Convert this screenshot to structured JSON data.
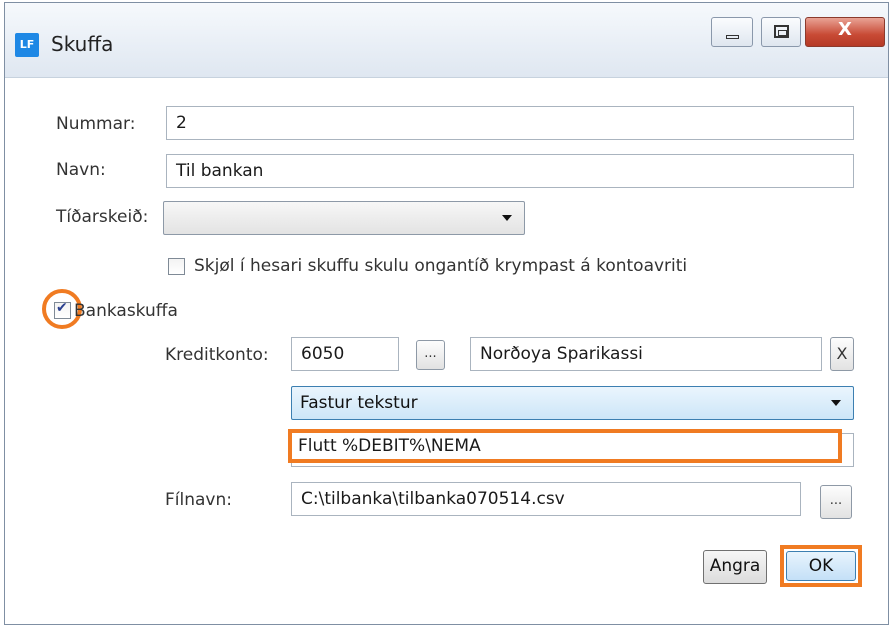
{
  "window": {
    "app_icon_text": "LF",
    "title": "Skuffa",
    "close_symbol": "X"
  },
  "form": {
    "nummar_label": "Nummar:",
    "nummar_value": "2",
    "navn_label": "Navn:",
    "navn_value": "Til bankan",
    "tidarskeid_label": "Tíðarskeið:",
    "tidarskeid_value": "",
    "shrink_checkbox_label": "Skjøl í hesari skuffu skulu ongantíð krympast á kontoavriti",
    "shrink_checked": false,
    "bankaskuffa_label": "Bankaskuffa",
    "bankaskuffa_checked": true,
    "kreditkonto_label": "Kreditkonto:",
    "kreditkonto_value": "6050",
    "browse_label": "...",
    "account_name": "Norðoya Sparikassi",
    "clear_label": "X",
    "text_mode_value": "Fastur tekstur",
    "text_value": "Flutt %DEBIT%\\NEMA",
    "filnavn_label": "Fílnavn:",
    "filnavn_value": "C:\\tilbanka\\tilbanka070514.csv",
    "file_browse_label": "..."
  },
  "buttons": {
    "cancel": "Angra",
    "ok": "OK"
  },
  "colors": {
    "highlight": "#f07b22",
    "accent": "#1e88e5"
  }
}
